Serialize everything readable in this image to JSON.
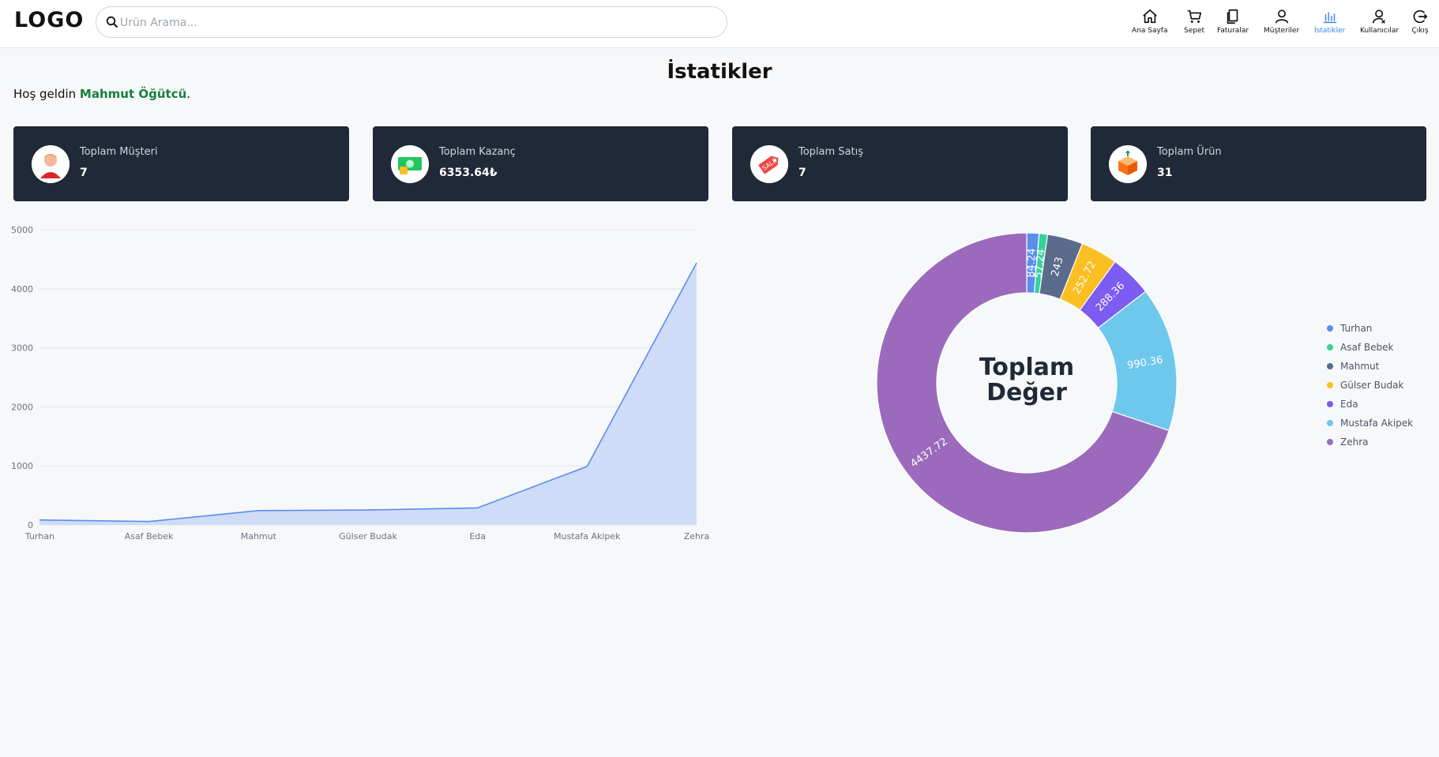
{
  "header": {
    "logo": "LOGO",
    "search_placeholder": "Ürün Arama...",
    "nav": [
      {
        "label": "Ana Sayfa",
        "icon": "home-icon"
      },
      {
        "label": "Sepet",
        "icon": "cart-icon"
      },
      {
        "label": "Faturalar",
        "icon": "invoice-icon"
      },
      {
        "label": "Müşteriler",
        "icon": "user-icon"
      },
      {
        "label": "İstatikler",
        "icon": "chart-icon",
        "active": true
      },
      {
        "label": "Kullanıcılar",
        "icon": "users-icon"
      },
      {
        "label": "Çıkış",
        "icon": "logout-icon"
      }
    ]
  },
  "page": {
    "title": "İstatikler",
    "welcome_prefix": "Hoş geldin ",
    "user_name": "Mahmut Öğütcü",
    "welcome_suffix": "."
  },
  "cards": [
    {
      "label": "Toplam Müşteri",
      "value": "7",
      "icon": "customer-icon"
    },
    {
      "label": "Toplam Kazanç",
      "value": "6353.64₺",
      "icon": "money-icon"
    },
    {
      "label": "Toplam Satış",
      "value": "7",
      "icon": "sale-tag-icon"
    },
    {
      "label": "Toplam Ürün",
      "value": "31",
      "icon": "box-icon"
    }
  ],
  "chart_data": [
    {
      "type": "area",
      "categories": [
        "Turhan",
        "Asaf Bebek",
        "Mahmut",
        "Gülser Budak",
        "Eda",
        "Mustafa Akipek",
        "Zehra"
      ],
      "values": [
        84.24,
        57.24,
        243,
        252.72,
        288.36,
        990.36,
        4437.72
      ],
      "ylim": [
        0,
        5000
      ],
      "yticks": [
        0,
        1000,
        2000,
        3000,
        4000,
        5000
      ],
      "grid": true,
      "color": "#5b8def",
      "fill": "#cfdcf7"
    },
    {
      "type": "pie",
      "donut": true,
      "center_title": [
        "Toplam",
        "Değer"
      ],
      "categories": [
        "Turhan",
        "Asaf Bebek",
        "Mahmut",
        "Gülser Budak",
        "Eda",
        "Mustafa Akipek",
        "Zehra"
      ],
      "values": [
        84.24,
        57.24,
        243,
        252.72,
        288.36,
        990.36,
        4437.72
      ],
      "colors": [
        "#5b8def",
        "#34d399",
        "#5b6b8c",
        "#fbbf24",
        "#7c5cf2",
        "#6ec8ec",
        "#9b6abd"
      ],
      "legend": "right"
    }
  ]
}
